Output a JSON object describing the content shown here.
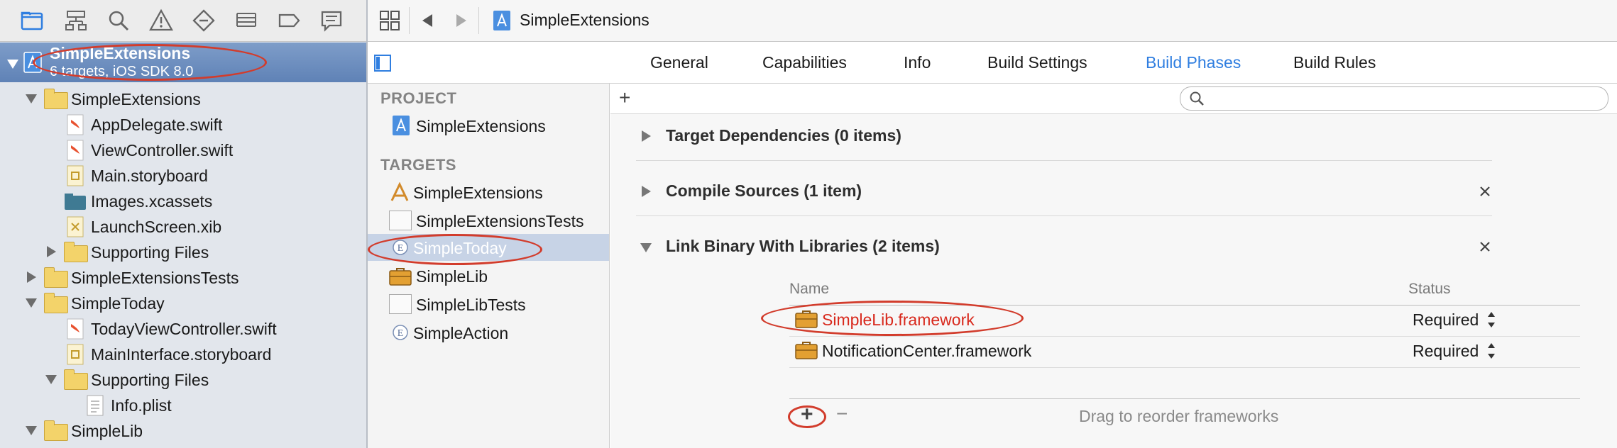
{
  "navigator": {
    "toolbar_icons": [
      "folder-icon",
      "hierarchy-icon",
      "search-icon",
      "warning-icon",
      "test-icon",
      "debug-icon",
      "breakpoint-icon",
      "log-icon"
    ],
    "project": {
      "name": "SimpleExtensions",
      "subtitle": "6 targets, iOS SDK 8.0"
    },
    "tree": [
      {
        "label": "SimpleExtensions",
        "kind": "folder",
        "expanded": true
      },
      {
        "label": "AppDelegate.swift",
        "kind": "swift"
      },
      {
        "label": "ViewController.swift",
        "kind": "swift"
      },
      {
        "label": "Main.storyboard",
        "kind": "storyboard"
      },
      {
        "label": "Images.xcassets",
        "kind": "assets"
      },
      {
        "label": "LaunchScreen.xib",
        "kind": "xib"
      },
      {
        "label": "Supporting Files",
        "kind": "folder",
        "expanded": false
      },
      {
        "label": "SimpleExtensionsTests",
        "kind": "folder",
        "expanded": false
      },
      {
        "label": "SimpleToday",
        "kind": "folder",
        "expanded": true
      },
      {
        "label": "TodayViewController.swift",
        "kind": "swift"
      },
      {
        "label": "MainInterface.storyboard",
        "kind": "storyboard"
      },
      {
        "label": "Supporting Files",
        "kind": "folder",
        "expanded": true
      },
      {
        "label": "Info.plist",
        "kind": "plist"
      },
      {
        "label": "SimpleLib",
        "kind": "folder",
        "expanded": true
      }
    ]
  },
  "jump_bar": {
    "crumb": "SimpleExtensions"
  },
  "tabs": [
    "General",
    "Capabilities",
    "Info",
    "Build Settings",
    "Build Phases",
    "Build Rules"
  ],
  "active_tab": "Build Phases",
  "accent_color": "#2f7ee0",
  "annotation_color": "#d23c2c",
  "project_section": {
    "header": "PROJECT",
    "item": "SimpleExtensions"
  },
  "targets_section": {
    "header": "TARGETS",
    "items": [
      "SimpleExtensions",
      "SimpleExtensionsTests",
      "SimpleToday",
      "SimpleLib",
      "SimpleLibTests",
      "SimpleAction"
    ],
    "selected": "SimpleToday"
  },
  "build_phases": {
    "add_symbol": "+",
    "phases": [
      {
        "title": "Target Dependencies (0 items)"
      },
      {
        "title": "Compile Sources (1 item)"
      },
      {
        "title": "Link Binary With Libraries (2 items)"
      }
    ],
    "libraries": {
      "col_name": "Name",
      "col_status": "Status",
      "rows": [
        {
          "name": "SimpleLib.framework",
          "status": "Required",
          "missing": true
        },
        {
          "name": "NotificationCenter.framework",
          "status": "Required",
          "missing": false
        }
      ],
      "add_symbol": "+",
      "remove_symbol": "−",
      "footer_hint": "Drag to reorder frameworks"
    }
  }
}
